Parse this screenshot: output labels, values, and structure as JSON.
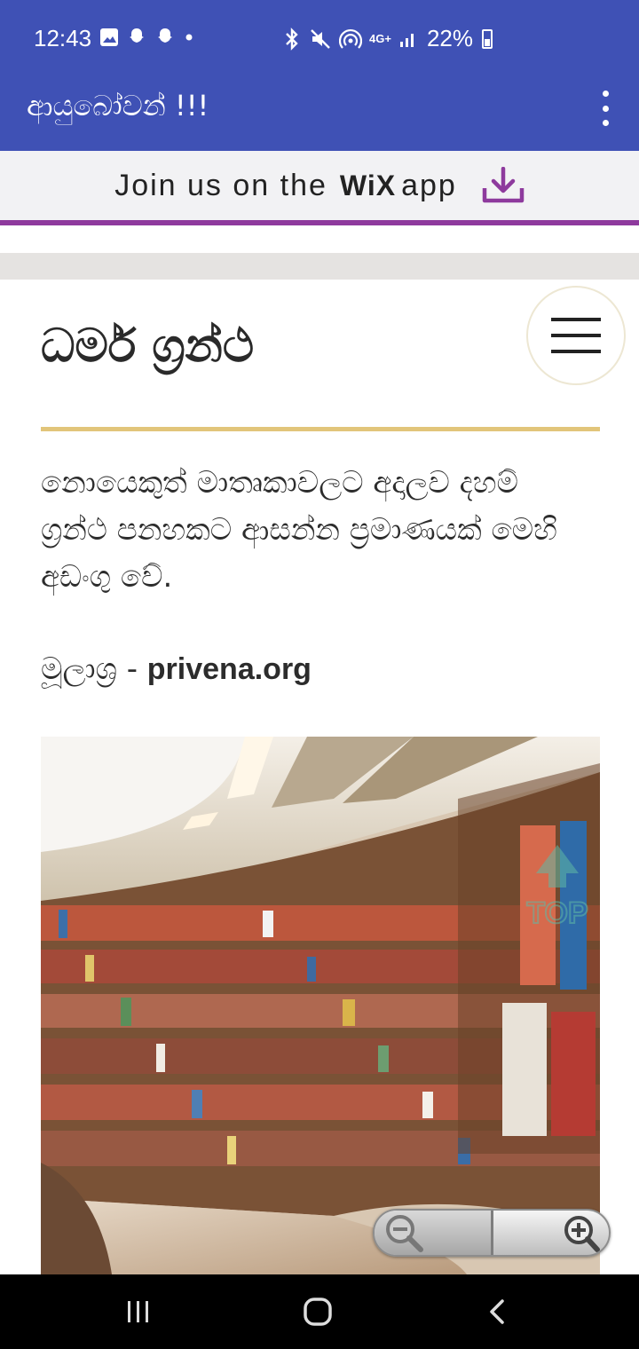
{
  "status_bar": {
    "time": "12:43",
    "battery": "22%",
    "network": "4G+",
    "icons": [
      "gallery-icon",
      "snapchat-icon",
      "snapchat-icon",
      "dot-icon",
      "bluetooth-icon",
      "mute-icon",
      "hotspot-icon",
      "signal-icon",
      "battery-icon"
    ]
  },
  "app_bar": {
    "title": "ආයුබෝවන් !!!",
    "menu_icon": "more-vertical-icon"
  },
  "wix_banner": {
    "text": "Join us on the",
    "brand": "WiX",
    "suffix": "app",
    "icon": "download-icon",
    "accent": "#8e3a9d"
  },
  "content": {
    "title": "ධර්ම ග්‍රන්ථ",
    "description": "නොයෙකුත් මාතෘකාවලට අදාලව දහම් ග්‍රන්ථ පනහකට ආසන්න ප්‍රමාණයක් මෙහි අඩංගු වේ.",
    "source_label": "මූලාශ්‍ර - ",
    "source_value": "privena.org",
    "image": "library-bookshelves",
    "divider_color": "#e2c57a"
  },
  "overlay": {
    "top_button": "TOP"
  },
  "colors": {
    "primary": "#3f51b5",
    "banner_bg": "#f2f2f4"
  }
}
